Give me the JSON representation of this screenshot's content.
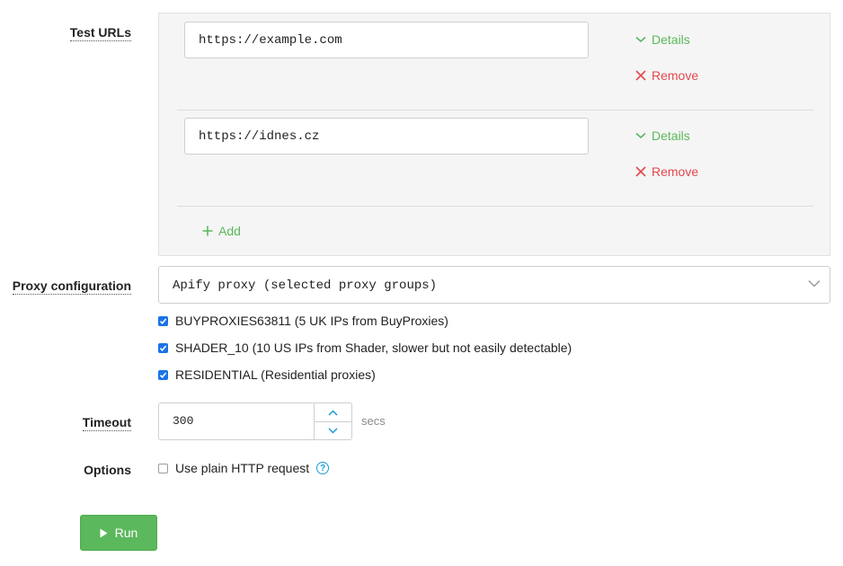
{
  "labels": {
    "test_urls": "Test URLs",
    "proxy_configuration": "Proxy configuration",
    "timeout": "Timeout",
    "options": "Options"
  },
  "test_urls": {
    "items": [
      {
        "value": "https://example.com",
        "details_label": "Details",
        "remove_label": "Remove"
      },
      {
        "value": "https://idnes.cz",
        "details_label": "Details",
        "remove_label": "Remove"
      }
    ],
    "add_label": "Add"
  },
  "proxy": {
    "selected": "Apify proxy (selected proxy groups)",
    "groups": [
      {
        "label": "BUYPROXIES63811 (5 UK IPs from BuyProxies)",
        "checked": true
      },
      {
        "label": "SHADER_10 (10 US IPs from Shader, slower but not easily detectable)",
        "checked": true
      },
      {
        "label": "RESIDENTIAL (Residential proxies)",
        "checked": true
      }
    ]
  },
  "timeout": {
    "value": "300",
    "unit": "secs"
  },
  "options": {
    "plain_http_label": "Use plain HTTP request",
    "plain_http_checked": false,
    "help_glyph": "?"
  },
  "run_label": "Run",
  "colors": {
    "green": "#5cb85c",
    "red": "#e5484d",
    "blue": "#1a73e8",
    "help": "#1a9bd7"
  }
}
